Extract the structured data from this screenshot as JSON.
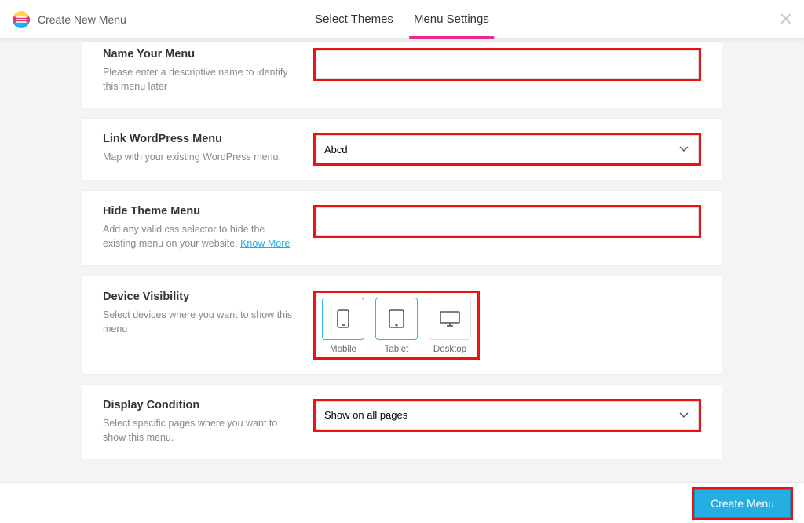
{
  "header": {
    "page_title": "Create New Menu",
    "tabs": {
      "select_themes": "Select Themes",
      "menu_settings": "Menu Settings"
    }
  },
  "sections": {
    "name": {
      "title": "Name Your Menu",
      "desc": "Please enter a descriptive name to identify this menu later",
      "value": ""
    },
    "link_wp": {
      "title": "Link WordPress Menu",
      "desc": "Map with your existing WordPress menu.",
      "value": "Abcd",
      "options": [
        "Abcd"
      ]
    },
    "hide_theme": {
      "title": "Hide Theme Menu",
      "desc_pre": "Add any valid css selector to hide the existing menu on your website. ",
      "link": "Know More",
      "value": ""
    },
    "device": {
      "title": "Device Visibility",
      "desc": "Select devices where you want to show this menu",
      "labels": {
        "mobile": "Mobile",
        "tablet": "Tablet",
        "desktop": "Desktop"
      },
      "selected": {
        "mobile": true,
        "tablet": true,
        "desktop": false
      }
    },
    "display": {
      "title": "Display Condition",
      "desc": "Select specific pages where you want to show this menu.",
      "value": "Show on all pages",
      "options": [
        "Show on all pages"
      ]
    }
  },
  "footer": {
    "create_label": "Create Menu"
  }
}
